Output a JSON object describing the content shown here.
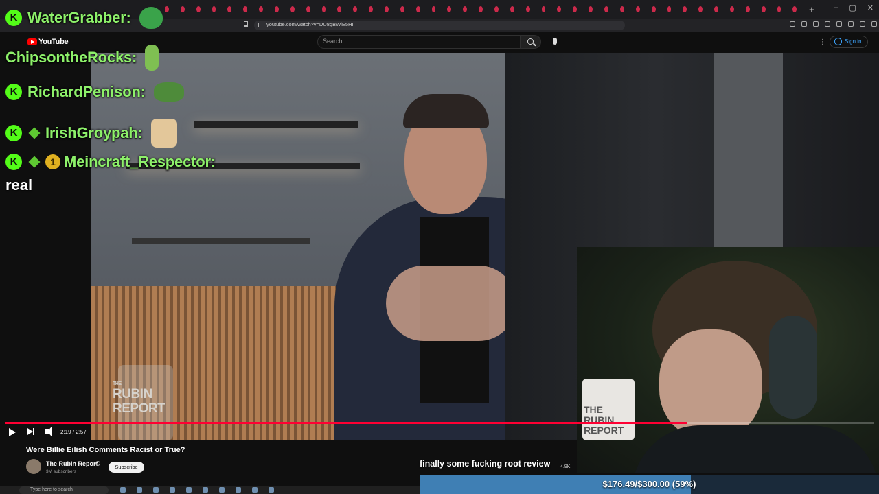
{
  "browser": {
    "url": "youtube.com/watch?v=DU8gBWiE5HI",
    "tab_count": 41
  },
  "youtube": {
    "logo_text": "YouTube",
    "search_placeholder": "Search",
    "sign_in_label": "Sign in"
  },
  "player": {
    "time": "2:19 / 2:57",
    "progress_fraction": 0.7853,
    "watermark_line1": "THE",
    "watermark_line2": "RUBIN",
    "watermark_line3": "REPORT"
  },
  "video_info": {
    "title": "Were Billie Eilish Comments Racist or True?",
    "channel_name": "The Rubin Report",
    "subscribers": "3M subscribers",
    "subscribe_label": "Subscribe"
  },
  "chat": {
    "messages": [
      {
        "username": "WaterGrabber:",
        "badges": [
          "kick"
        ],
        "emote": "frog"
      },
      {
        "username": "ChipsontheRocks:",
        "badges": [],
        "emote": "pickle"
      },
      {
        "username": "RichardPenison:",
        "badges": [
          "kick"
        ],
        "emote": "pepe"
      },
      {
        "username": "IrishGroypah:",
        "badges": [
          "kick",
          "diamond"
        ],
        "emote": "scream"
      },
      {
        "username": "Meincraft_Respector:",
        "badges": [
          "kick",
          "diamond",
          "sub"
        ],
        "emote": ""
      }
    ],
    "last_message_text": "real",
    "kick_badge_letter": "K",
    "sub_badge_number": "1"
  },
  "overlay": {
    "tts_message": "finally some fucking root review",
    "tts_count": "4.9K",
    "goal_text": "$176.49/$300.00 (59%)",
    "goal_fraction": 0.59
  },
  "mug_text": "THE RUBIN REPORT",
  "taskbar": {
    "search_placeholder": "Type here to search"
  },
  "colors": {
    "youtube_red": "#ff0000",
    "progress_red": "#ff0033",
    "kick_green": "#53fc18",
    "chat_name_green": "#8df06a",
    "goal_blue": "#3f7fb4"
  }
}
